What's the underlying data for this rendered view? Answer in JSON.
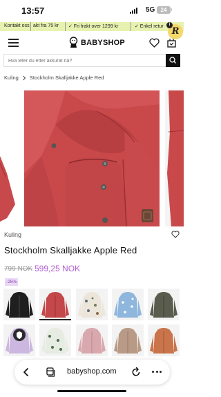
{
  "status": {
    "time": "13:57",
    "network": "5G",
    "battery": "24"
  },
  "promo": {
    "items": [
      "Kontakt oss",
      "akt fra 75 kr",
      "✓ Fri frakt over 1299 kr",
      "✓ Enkel retur"
    ],
    "color": "#e8f2b0"
  },
  "header": {
    "logo_text": "BABYSHOP"
  },
  "search": {
    "placeholder": "Hva leter du etter akkurat nå?"
  },
  "breadcrumb": [
    "Kuling",
    "Stockholm Skalljakke Apple Red"
  ],
  "product": {
    "brand": "Kuling",
    "title": "Stockholm Skalljakke Apple Red",
    "old_price": "799 NOK",
    "new_price": "599,25 NOK",
    "discount": "-25%",
    "accent": "#b45fd0",
    "main_color": "#c4474a"
  },
  "swatches": [
    {
      "name": "black",
      "color": "#1f1f1f"
    },
    {
      "name": "apple-red",
      "color": "#c4474a",
      "selected": true
    },
    {
      "name": "cream-print",
      "color": "#ece6da"
    },
    {
      "name": "blue-print",
      "color": "#8fb6dc"
    },
    {
      "name": "olive",
      "color": "#5a5c4e"
    },
    {
      "name": "lilac",
      "color": "#cbb7df"
    },
    {
      "name": "green-print",
      "color": "#e7ece3"
    },
    {
      "name": "pink",
      "color": "#d9a8ae"
    },
    {
      "name": "beige",
      "color": "#b89a86"
    },
    {
      "name": "orange",
      "color": "#c9744b"
    }
  ],
  "browser": {
    "url": "babyshop.com"
  }
}
